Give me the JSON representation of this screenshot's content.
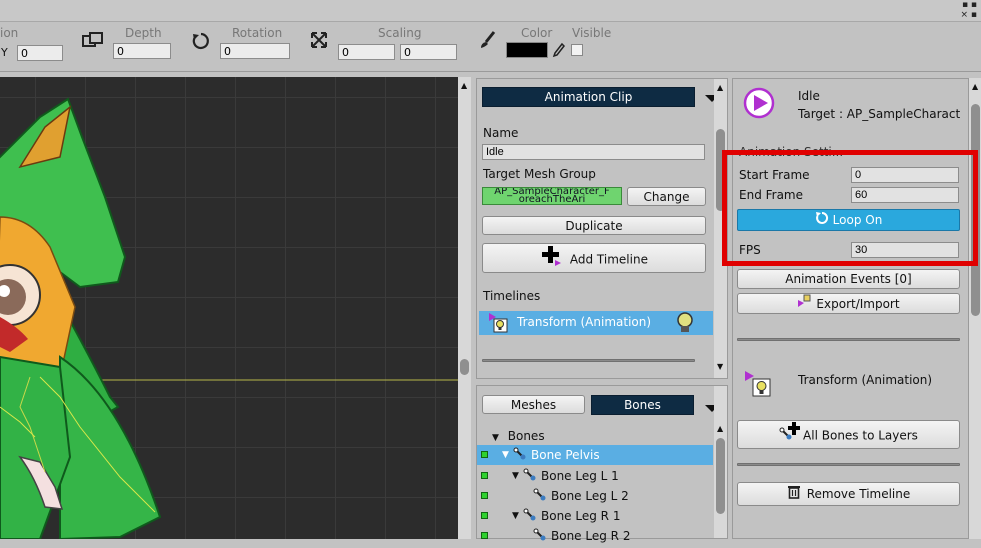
{
  "window": {
    "controls": [
      "▪ ▪",
      "× ▪"
    ]
  },
  "toolbar": {
    "partial_label": "ion",
    "y_label": "Y",
    "y_value": "0",
    "depth_label": "Depth",
    "depth_value": "0",
    "rotation_label": "Rotation",
    "rotation_value": "0",
    "scaling_label": "Scaling",
    "scaling_x": "0",
    "scaling_y": "0",
    "color_label": "Color",
    "visible_label": "Visible",
    "color_value": "#000000"
  },
  "clip_panel": {
    "header_button": "Animation Clip",
    "name_label": "Name",
    "name_value": "Idle",
    "target_mesh_group_label": "Target Mesh Group",
    "target_mesh_group_value": "AP_SampleCharacter_F",
    "target_mesh_group_value2": "oreachTheAri",
    "change_button": "Change",
    "duplicate_button": "Duplicate",
    "add_timeline_button": "Add Timeline",
    "timelines_label": "Timelines",
    "timeline_item": "Transform (Animation)"
  },
  "bones_panel": {
    "meshes_tab": "Meshes",
    "bones_tab": "Bones",
    "root_label": "Bones",
    "items": [
      {
        "label": "Bone Pelvis"
      },
      {
        "label": "Bone Leg L 1"
      },
      {
        "label": "Bone Leg L 2"
      },
      {
        "label": "Bone Leg R 1"
      },
      {
        "label": "Bone Leg R 2"
      }
    ]
  },
  "right_panel": {
    "clip_name": "Idle",
    "target_text": "Target : AP_SampleCharact",
    "settings_label": "Animation Setti...",
    "start_frame_label": "Start Frame",
    "start_frame_value": "0",
    "end_frame_label": "End Frame",
    "end_frame_value": "60",
    "loop_button": "Loop On",
    "fps_label": "FPS",
    "fps_value": "30",
    "events_button": "Animation Events [0]",
    "export_button": "Export/Import",
    "timeline_name": "Transform (Animation)",
    "all_bones_button": "All Bones to Layers",
    "remove_timeline_button": "Remove Timeline"
  },
  "colors": {
    "highlight_box": "#e00000",
    "selection": "#5aaee3",
    "loop_button": "#2aa8dd",
    "dark_button": "#0e2b43"
  }
}
